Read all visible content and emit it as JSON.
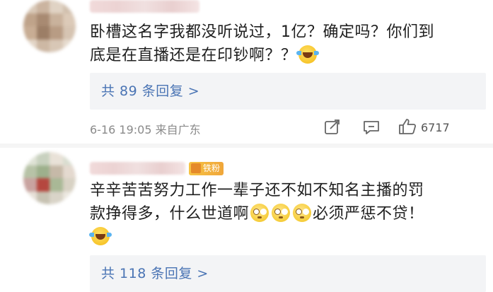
{
  "comments": [
    {
      "text_line1": "卧槽这名字我都没听说过，1亿？确定吗？你们到",
      "text_line2_a": "底是在直播还是在印钞啊？？",
      "emoji_1": "laugh-cry-emoji",
      "reply_label": "共 89 条回复 >",
      "time_location": "6-16 19:05  来自广东",
      "like_count": "6717"
    },
    {
      "badge": "铁粉",
      "text_line1": "辛辛苦苦努力工作一辈子还不如不知名主播的罚",
      "text_line2_a": "款挣得多，什么世道啊",
      "text_line2_b": "必须严惩不贷！",
      "emojis": [
        "eye-roll-emoji",
        "eye-roll-emoji",
        "eye-roll-emoji"
      ],
      "emoji_last": "laugh-cry-emoji",
      "reply_label": "共 118 条回复 >"
    }
  ],
  "icons": {
    "share": "share-icon",
    "comment": "comment-icon",
    "like": "thumbs-up-icon"
  },
  "colors": {
    "reply_link": "#4a74b4",
    "reply_bg": "#f3f4f6",
    "meta_text": "#8a8a8a"
  }
}
